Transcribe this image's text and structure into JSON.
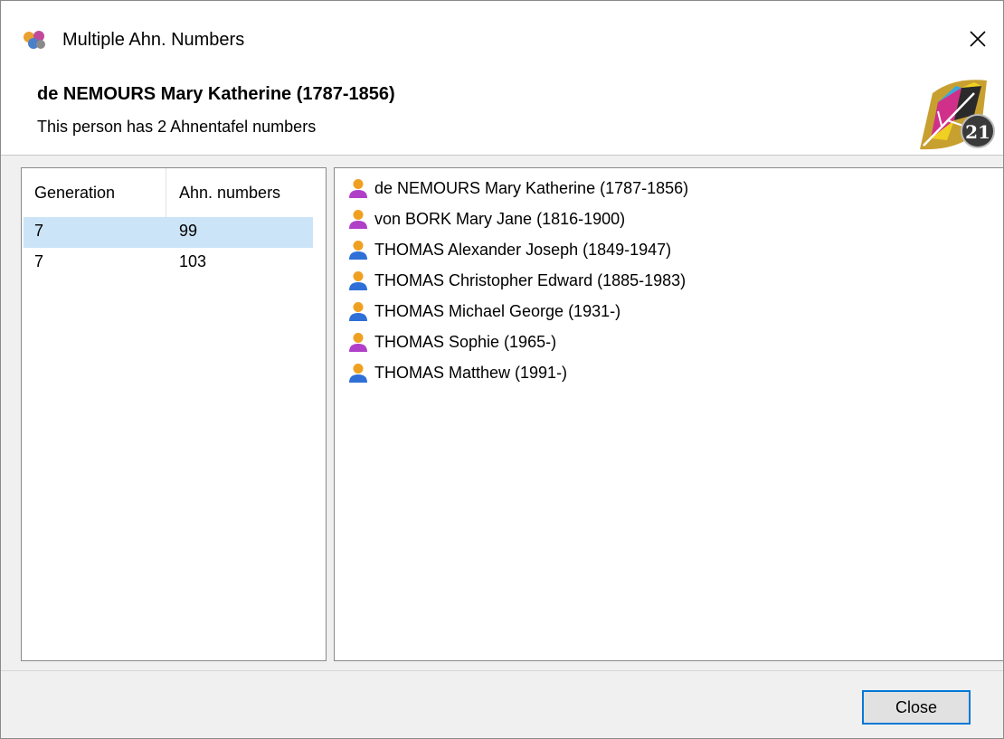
{
  "window": {
    "title": "Multiple Ahn. Numbers",
    "close_glyph": "✕"
  },
  "header": {
    "person": "de NEMOURS Mary Katherine (1787-1856)",
    "subtitle": "This person has 2 Ahnentafel numbers"
  },
  "table": {
    "columns": [
      "Generation",
      "Ahn. numbers"
    ],
    "rows": [
      {
        "generation": "7",
        "ahn": "99",
        "selected": true
      },
      {
        "generation": "7",
        "ahn": "103",
        "selected": false
      }
    ]
  },
  "lineage": [
    {
      "name": "de NEMOURS Mary Katherine (1787-1856)",
      "sex": "female"
    },
    {
      "name": "von BORK Mary Jane (1816-1900)",
      "sex": "female"
    },
    {
      "name": "THOMAS Alexander Joseph (1849-1947)",
      "sex": "male"
    },
    {
      "name": "THOMAS Christopher Edward (1885-1983)",
      "sex": "male"
    },
    {
      "name": "THOMAS Michael George (1931-)",
      "sex": "male"
    },
    {
      "name": "THOMAS Sophie (1965-)",
      "sex": "female"
    },
    {
      "name": "THOMAS Matthew (1991-)",
      "sex": "male"
    }
  ],
  "icons": {
    "app": "family-tree-app-icon",
    "female": "female-person-icon",
    "male": "male-person-icon",
    "brand": "brand-logo-21"
  },
  "colors": {
    "female_head": "#f0a020",
    "female_body": "#b040c8",
    "male_head": "#f0a020",
    "male_body": "#2f6fd8",
    "selection": "#cce4f7",
    "button_focus": "#0078d7"
  },
  "buttons": {
    "close": "Close"
  }
}
